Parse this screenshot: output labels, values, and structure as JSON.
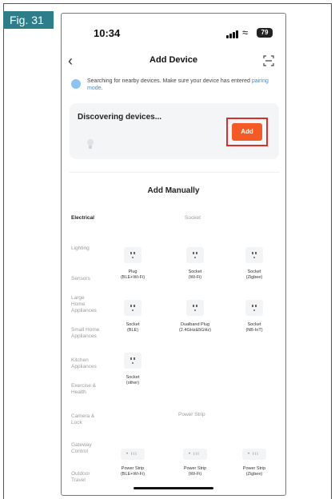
{
  "figure_label": "Fig. 31",
  "status_bar": {
    "time": "10:34",
    "battery": "79"
  },
  "nav": {
    "title": "Add Device",
    "back_icon": "chevron-left-icon",
    "scan_icon": "scan-icon"
  },
  "search_note": {
    "text": "Searching for nearby devices. Make sure your device has entered ",
    "link": "pairing mode",
    "suffix": "."
  },
  "discover": {
    "title": "Discovering devices...",
    "add_label": "Add",
    "accent": "#f45a26",
    "highlight": "#d9302b"
  },
  "manual": {
    "title": "Add Manually"
  },
  "sidebar": {
    "items": [
      {
        "label": "Electrical",
        "active": true
      },
      {
        "label": "Lighting"
      },
      {
        "label": "Sensors"
      },
      {
        "label": "Large Home Appliances"
      },
      {
        "label": "Small Home Appliances"
      },
      {
        "label": "Kitchen Appliances"
      },
      {
        "label": "Exercise & Health"
      },
      {
        "label": "Camera & Lock"
      },
      {
        "label": "Gateway Control"
      },
      {
        "label": "Outdoor Travel"
      }
    ]
  },
  "socket_section": {
    "title": "Socket",
    "devices": [
      {
        "name": "Plug",
        "sub": "(BLE+Wi-Fi)"
      },
      {
        "name": "Socket",
        "sub": "(Wi-Fi)"
      },
      {
        "name": "Socket",
        "sub": "(Zigbee)"
      },
      {
        "name": "Socket",
        "sub": "(BLE)"
      },
      {
        "name": "Dualband Plug",
        "sub": "(2.4GHz&5GHz)"
      },
      {
        "name": "Socket",
        "sub": "(NB-IoT)"
      },
      {
        "name": "Socket",
        "sub": "(other)"
      }
    ]
  },
  "strip_section": {
    "title": "Power Strip",
    "devices": [
      {
        "name": "Power Strip",
        "sub": "(BLE+Wi-Fi)"
      },
      {
        "name": "Power Strip",
        "sub": "(Wi-Fi)"
      },
      {
        "name": "Power Strip",
        "sub": "(Zigbee)"
      }
    ]
  }
}
